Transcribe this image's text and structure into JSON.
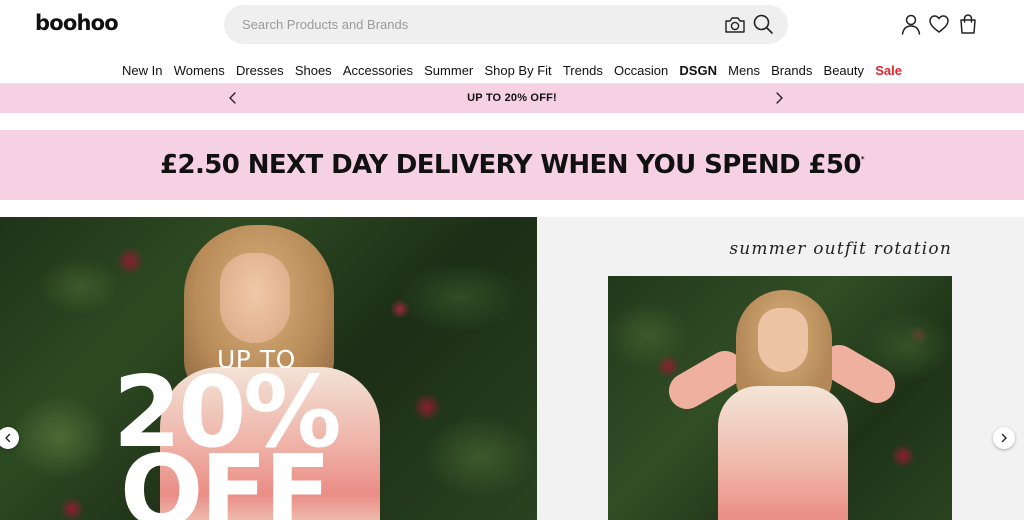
{
  "header": {
    "logo": "boohoo",
    "search_placeholder": "Search Products and Brands",
    "icons": {
      "camera": "camera-icon",
      "search": "search-icon",
      "account": "account-icon",
      "wishlist": "heart-icon",
      "bag": "bag-icon"
    }
  },
  "nav": {
    "items": [
      {
        "label": "New In"
      },
      {
        "label": "Womens"
      },
      {
        "label": "Dresses"
      },
      {
        "label": "Shoes"
      },
      {
        "label": "Accessories"
      },
      {
        "label": "Summer"
      },
      {
        "label": "Shop By Fit"
      },
      {
        "label": "Trends"
      },
      {
        "label": "Occasion"
      },
      {
        "label": "DSGN"
      },
      {
        "label": "Mens"
      },
      {
        "label": "Brands"
      },
      {
        "label": "Beauty"
      },
      {
        "label": "Sale"
      }
    ]
  },
  "promo": {
    "text": "UP TO 20% OFF!"
  },
  "delivery": {
    "text": "£2.50 NEXT DAY DELIVERY WHEN YOU SPEND £50",
    "mark": "*"
  },
  "hero": {
    "up_to": "UP TO",
    "percent": "20%",
    "off": "OFF",
    "tagline": "summer outfit rotation"
  },
  "colors": {
    "brand_pink": "#f6d0e3",
    "sale_red": "#e0232c",
    "search_bg": "#efefef"
  }
}
